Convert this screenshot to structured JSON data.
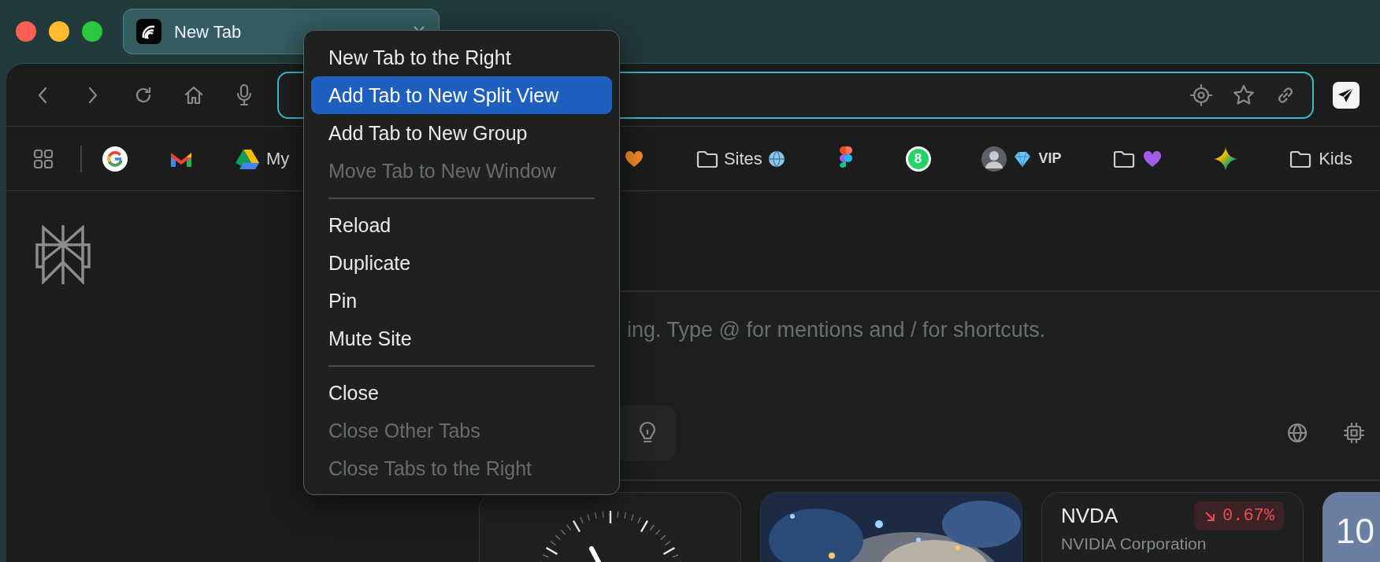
{
  "tabs": [
    {
      "title": "New Tab",
      "selected": true
    }
  ],
  "bookmarks": [
    {
      "kind": "apps"
    },
    {
      "kind": "google"
    },
    {
      "kind": "gmail"
    },
    {
      "kind": "drive",
      "label": "My"
    },
    {
      "kind": "heart",
      "color": "#f28a26"
    },
    {
      "kind": "webfolder",
      "label": "Sites"
    },
    {
      "kind": "figma"
    },
    {
      "kind": "whatsapp",
      "badge": "8"
    },
    {
      "kind": "avatar",
      "label": "VIP"
    },
    {
      "kind": "heartfolder",
      "color": "#a35ce8"
    },
    {
      "kind": "gemini"
    },
    {
      "kind": "folder",
      "label": "Kids"
    }
  ],
  "menu": {
    "items": [
      {
        "kind": "item",
        "label": "New Tab to the Right",
        "selected": false,
        "disabled": false
      },
      {
        "kind": "item",
        "label": "Add Tab to New Split View",
        "selected": true,
        "disabled": false
      },
      {
        "kind": "item",
        "label": "Add Tab to New Group",
        "selected": false,
        "disabled": false
      },
      {
        "kind": "item",
        "label": "Move Tab to New Window",
        "selected": false,
        "disabled": true
      },
      {
        "kind": "separator"
      },
      {
        "kind": "item",
        "label": "Reload",
        "selected": false,
        "disabled": false
      },
      {
        "kind": "item",
        "label": "Duplicate",
        "selected": false,
        "disabled": false
      },
      {
        "kind": "item",
        "label": "Pin",
        "selected": false,
        "disabled": false
      },
      {
        "kind": "item",
        "label": "Mute Site",
        "selected": false,
        "disabled": false
      },
      {
        "kind": "separator"
      },
      {
        "kind": "item",
        "label": "Close",
        "selected": false,
        "disabled": false
      },
      {
        "kind": "item",
        "label": "Close Other Tabs",
        "selected": false,
        "disabled": true
      },
      {
        "kind": "item",
        "label": "Close Tabs to the Right",
        "selected": false,
        "disabled": true
      }
    ]
  },
  "composer": {
    "placeholder": "ing. Type @ for mentions and / for shortcuts."
  },
  "cards": [
    {
      "kind": "clock"
    },
    {
      "kind": "picture"
    },
    {
      "kind": "stock",
      "symbol": "NVDA",
      "change": "0.67%",
      "falling": true,
      "company": "NVIDIA Corporation"
    },
    {
      "kind": "number",
      "value": "10"
    }
  ]
}
